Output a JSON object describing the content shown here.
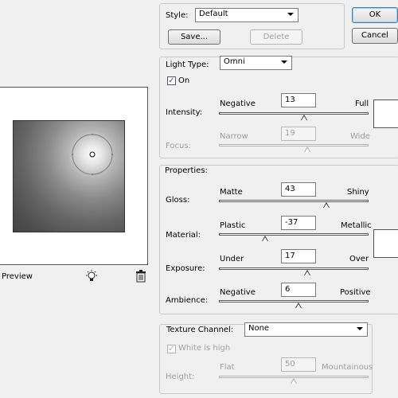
{
  "style": {
    "label": "Style:",
    "value": "Default",
    "save_label": "Save...",
    "delete_label": "Delete"
  },
  "buttons": {
    "ok": "OK",
    "cancel": "Cancel"
  },
  "light": {
    "type_label": "Light Type:",
    "type_value": "Omni",
    "on_label": "On",
    "on_checked": true,
    "intensity": {
      "label": "Intensity:",
      "min_label": "Negative",
      "max_label": "Full",
      "value": "13",
      "position": 0.57
    },
    "focus": {
      "label": "Focus:",
      "min_label": "Narrow",
      "max_label": "Wide",
      "value": "19",
      "position": 0.59,
      "disabled": true
    },
    "swatch_color": "#ffffff"
  },
  "properties": {
    "label": "Properties:",
    "gloss": {
      "label": "Gloss:",
      "min_label": "Matte",
      "max_label": "Shiny",
      "value": "43",
      "position": 0.72
    },
    "material": {
      "label": "Material:",
      "min_label": "Plastic",
      "max_label": "Metallic",
      "value": "-37",
      "position": 0.31
    },
    "exposure": {
      "label": "Exposure:",
      "min_label": "Under",
      "max_label": "Over",
      "value": "17",
      "position": 0.59
    },
    "ambience": {
      "label": "Ambience:",
      "min_label": "Negative",
      "max_label": "Positive",
      "value": "6",
      "position": 0.53
    },
    "swatch_color": "#ffffff"
  },
  "texture": {
    "label": "Texture Channel:",
    "value": "None",
    "white_is_high_label": "White is high",
    "white_is_high_checked": true,
    "height": {
      "label": "Height:",
      "min_label": "Flat",
      "max_label": "Mountainous",
      "value": "50",
      "position": 0.5,
      "disabled": true
    }
  },
  "preview": {
    "label": "Preview",
    "light_icon": "lightbulb-icon",
    "trash_icon": "trash-icon"
  }
}
